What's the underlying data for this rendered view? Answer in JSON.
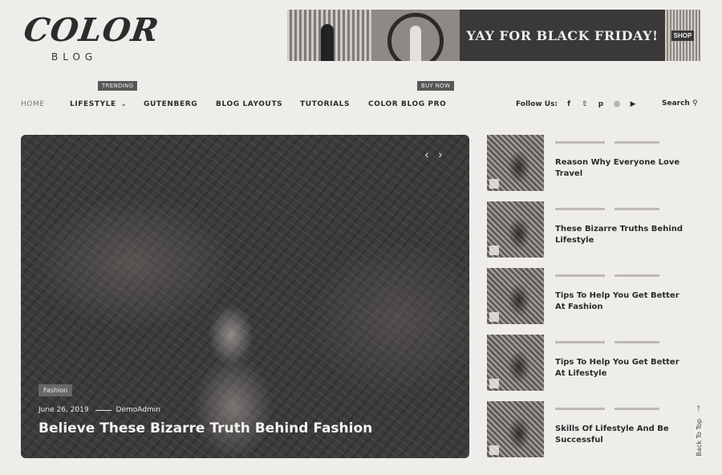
{
  "logo": {
    "mark": "COLOR",
    "sub": "BLOG"
  },
  "banner": {
    "text": "YAY FOR BLACK FRIDAY!",
    "badge": "SHOP"
  },
  "nav": {
    "items": [
      {
        "label": "HOME"
      },
      {
        "label": "LIFESTYLE"
      },
      {
        "label": "GUTENBERG"
      },
      {
        "label": "BLOG LAYOUTS"
      },
      {
        "label": "TUTORIALS"
      },
      {
        "label": "COLOR BLOG PRO"
      }
    ],
    "tags": {
      "trending": "TRENDING",
      "buy_now": "BUY NOW"
    },
    "follow_label": "Follow Us:",
    "social_icons": [
      "facebook-icon",
      "twitter-icon",
      "pinterest-icon",
      "instagram-icon",
      "youtube-icon"
    ],
    "search_label": "Search"
  },
  "hero": {
    "category": "Fashion",
    "date": "June 26, 2019",
    "author": "DemoAdmin",
    "title": "Believe These Bizarre Truth Behind Fashion"
  },
  "sidebar_posts": [
    {
      "title": "Reason Why Everyone Love Travel"
    },
    {
      "title": "These Bizarre Truths Behind Lifestyle"
    },
    {
      "title": "Tips To Help You Get Better At Fashion"
    },
    {
      "title": "Tips To Help You Get Better At Lifestyle"
    },
    {
      "title": "Skills Of Lifestyle And Be Successful"
    }
  ],
  "back_to_top": "Back To Top"
}
